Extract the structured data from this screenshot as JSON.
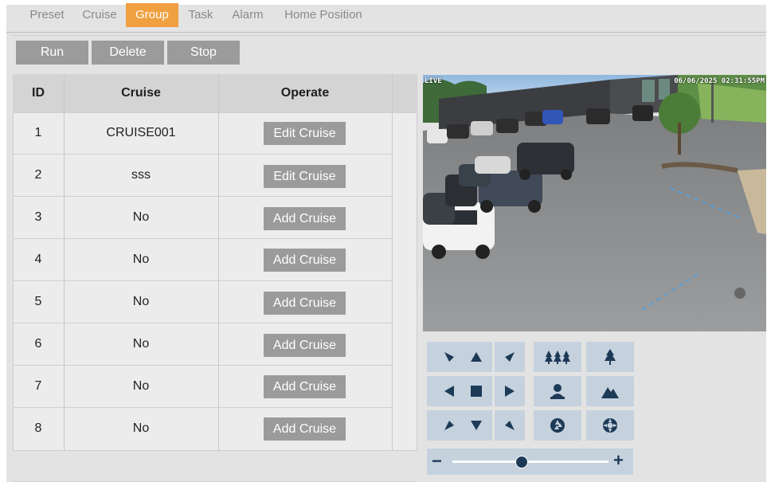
{
  "tabs": [
    {
      "label": "Preset",
      "active": false
    },
    {
      "label": "Cruise",
      "active": false
    },
    {
      "label": "Group",
      "active": true
    },
    {
      "label": "Task",
      "active": false
    },
    {
      "label": "Alarm",
      "active": false
    },
    {
      "label": "Home Position",
      "active": false
    }
  ],
  "toolbar": {
    "run_label": "Run",
    "delete_label": "Delete",
    "stop_label": "Stop"
  },
  "table": {
    "headers": {
      "id": "ID",
      "cruise": "Cruise",
      "operate": "Operate"
    },
    "rows": [
      {
        "id": "1",
        "cruise": "CRUISE001",
        "operate": "Edit Cruise"
      },
      {
        "id": "2",
        "cruise": "sss",
        "operate": "Edit Cruise"
      },
      {
        "id": "3",
        "cruise": "No",
        "operate": "Add Cruise"
      },
      {
        "id": "4",
        "cruise": "No",
        "operate": "Add Cruise"
      },
      {
        "id": "5",
        "cruise": "No",
        "operate": "Add Cruise"
      },
      {
        "id": "6",
        "cruise": "No",
        "operate": "Add Cruise"
      },
      {
        "id": "7",
        "cruise": "No",
        "operate": "Add Cruise"
      },
      {
        "id": "8",
        "cruise": "No",
        "operate": "Add Cruise"
      }
    ]
  },
  "video": {
    "osd_left": "LIVE",
    "osd_timestamp": "06/06/2025 02:31:55PM"
  },
  "ptz": {
    "buttons": [
      {
        "name": "pan-up-left-button",
        "icon": "arrow-up-left-icon"
      },
      {
        "name": "pan-up-button",
        "icon": "arrow-up-icon"
      },
      {
        "name": "pan-up-right-button",
        "icon": "arrow-up-right-icon"
      },
      {
        "name": "focus-far-button",
        "icon": "trees-far-icon"
      },
      {
        "name": "focus-near-button",
        "icon": "tree-near-icon"
      },
      {
        "name": "pan-left-button",
        "icon": "arrow-left-icon"
      },
      {
        "name": "ptz-stop-button",
        "icon": "stop-square-icon"
      },
      {
        "name": "pan-right-button",
        "icon": "arrow-right-icon"
      },
      {
        "name": "zoom-in-button",
        "icon": "person-icon"
      },
      {
        "name": "zoom-out-button",
        "icon": "mountain-icon"
      },
      {
        "name": "pan-down-left-button",
        "icon": "arrow-down-left-icon"
      },
      {
        "name": "pan-down-button",
        "icon": "arrow-down-icon"
      },
      {
        "name": "pan-down-right-button",
        "icon": "arrow-down-right-icon"
      },
      {
        "name": "iris-open-button",
        "icon": "aperture-open-icon"
      },
      {
        "name": "iris-close-button",
        "icon": "aperture-close-icon"
      }
    ],
    "zoom_minus": "−",
    "zoom_plus": "+",
    "speed_level": 0.44
  }
}
